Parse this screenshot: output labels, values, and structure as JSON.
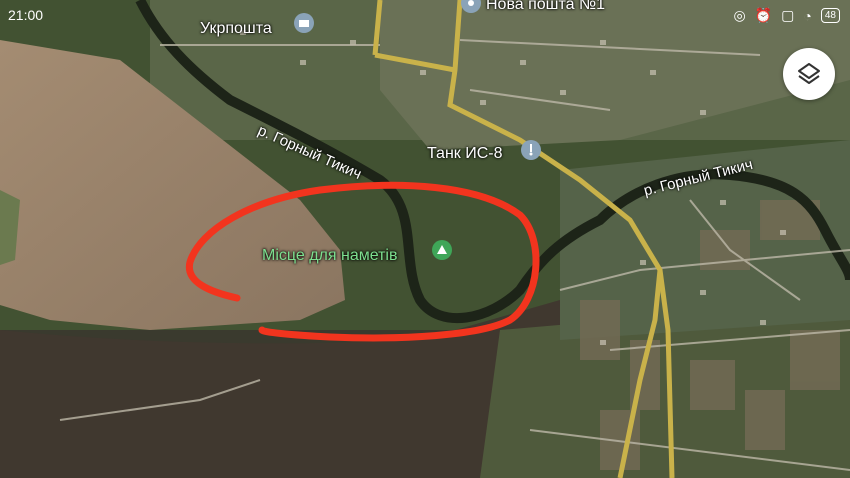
{
  "status_bar": {
    "time": "21:00",
    "battery": "48",
    "icons": [
      "hotspot-icon",
      "alarm-icon",
      "no-sim-icon",
      "wifi-icon",
      "battery-icon"
    ]
  },
  "map": {
    "type": "satellite",
    "places": {
      "ukrposhta": "Укрпошта",
      "nova_poshta": "Нова пошта №1",
      "tank": "Танк ИС-8",
      "campsite": "Місце для наметів"
    },
    "rivers": {
      "left": "р. Горный Тикич",
      "right": "р. Горный Тикич"
    },
    "annotation_color": "#f2341e",
    "road_color": "#c9b24a"
  },
  "controls": {
    "layers_icon": "layers-icon"
  }
}
